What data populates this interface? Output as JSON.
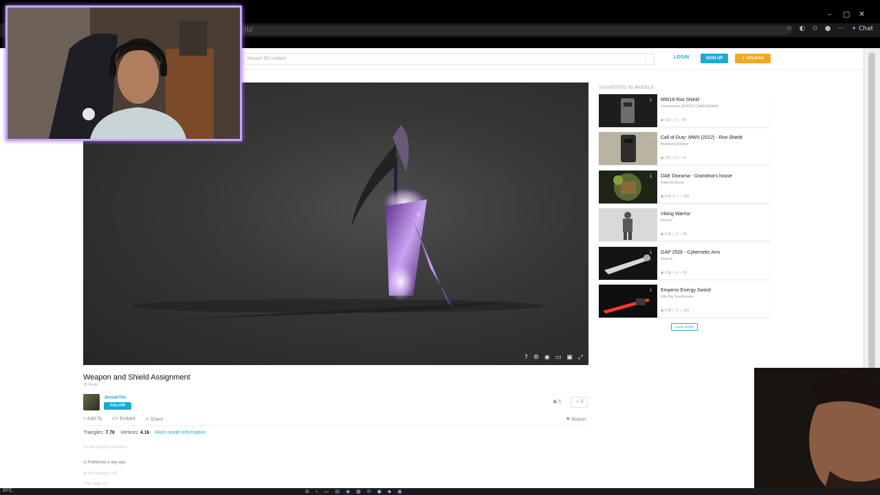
{
  "browser": {
    "url": "/12",
    "window_controls": [
      "–",
      "▢",
      "✕"
    ],
    "chat_label": "Chat"
  },
  "header": {
    "search_placeholder": "Search 3D models",
    "login_label": "LOGIN",
    "signup_label": "SIGN UP",
    "upload_label": "UPLOAD"
  },
  "viewer": {
    "controls": [
      "?",
      "⚙",
      "◉",
      "▭",
      "▣",
      "⤢"
    ]
  },
  "model": {
    "title": "Weapon and Shield Assignment",
    "subtitle": "3D Model",
    "author": "JessieYin",
    "follow_label": "FOLLOW",
    "views": "5",
    "likes": "0",
    "add_to": "Add To",
    "embed": "Embed",
    "share": "Share",
    "report": "Report",
    "triangles_label": "Triangles:",
    "triangles": "7.7k",
    "vertices_label": "Vertices:",
    "vertices": "4.1k",
    "more_info": "More model information",
    "description": "No description provided",
    "published": "Published a day ago",
    "category": "No category set",
    "tags": "No tags set"
  },
  "suggested": {
    "heading": "SUGGESTED 3D MODELS",
    "load_more": "LOAD MORE",
    "items": [
      {
        "title": "MW19 Riot Shield",
        "author": "Xenophaues (GHOST CAMERAMAN)",
        "views": "712",
        "comments": "0",
        "likes": "43"
      },
      {
        "title": "Call of Duty: MWII (2022) - Riot Shield",
        "author": "thientrung2004ppr",
        "views": "137",
        "comments": "0",
        "likes": "14"
      },
      {
        "title": "DAE Diorama - Grandma's house",
        "author": "Kateryna Bryus",
        "views": "5.6k",
        "comments": "7",
        "likes": "206"
      },
      {
        "title": "Viking Warrior",
        "author": "Ilustros",
        "views": "2.4k",
        "comments": "0",
        "likes": "53"
      },
      {
        "title": "GAP 2526 - Cybernetic Arm",
        "author": "Skayvis",
        "views": "1.3k",
        "comments": "4",
        "likes": "53"
      },
      {
        "title": "Emperor Energy Sword",
        "author": "Elite Big Speakerman",
        "views": "2.3k",
        "comments": "3",
        "likes": "134"
      }
    ]
  },
  "taskbar": {
    "temperature": "20°C"
  },
  "colors": {
    "accent": "#1caad9",
    "upload": "#f5a623",
    "cam_border": "#c9a6ff"
  }
}
